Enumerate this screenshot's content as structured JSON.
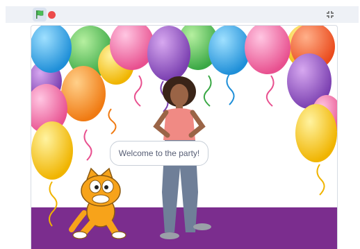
{
  "controls": {
    "green_flag_icon": "green-flag-icon",
    "stop_icon": "stop-icon",
    "fullscreen_icon": "exit-fullscreen-icon"
  },
  "stage": {
    "speech_bubble": "Welcome to the party!",
    "backdrop": "party-balloons",
    "floor_color": "#7b2d8e",
    "sprites": [
      "cat",
      "girl"
    ]
  },
  "colors": {
    "toolbar_bg": "#eef1f6",
    "flag_green": "#4cbf56",
    "stop_red": "#ec4b4b"
  }
}
